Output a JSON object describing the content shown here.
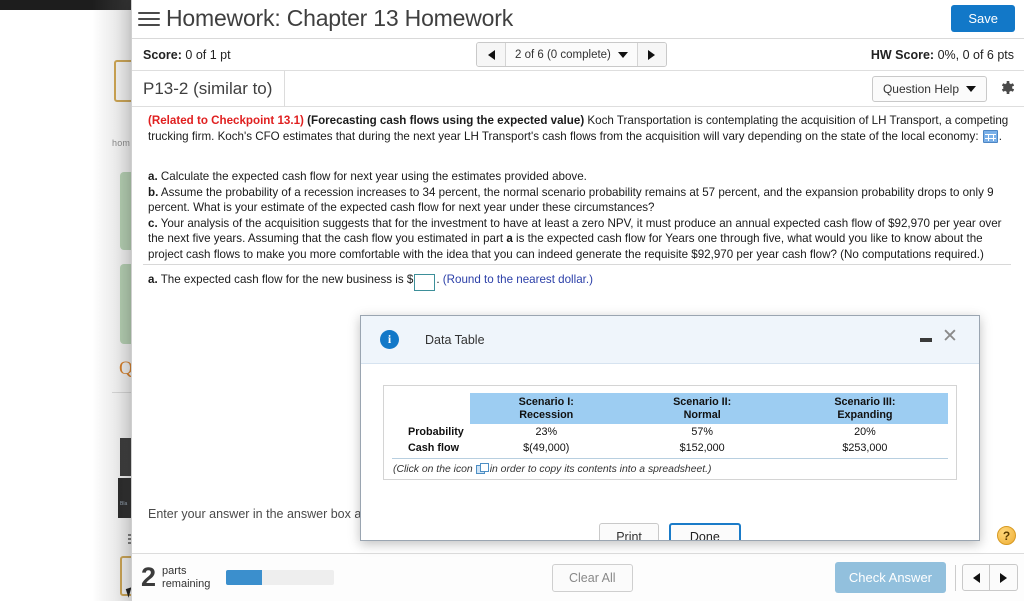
{
  "header": {
    "title": "Homework: Chapter 13 Homework",
    "save_label": "Save",
    "menu_icon": "hamburger-icon"
  },
  "score_row": {
    "score_label": "Score:",
    "score_value": "0 of 1 pt",
    "nav_value": "2 of 6 (0 complete)",
    "prev_icon": "triangle-left-icon",
    "next_icon": "triangle-right-icon",
    "hw_score_label": "HW Score:",
    "hw_score_value": "0%, 0 of 6 pts"
  },
  "problem_row": {
    "problem_id": "P13-2 (similar to)",
    "question_help_label": "Question Help",
    "gear_icon": "gear-icon"
  },
  "question": {
    "checkpoint": "(Related to Checkpoint 13.1)",
    "topic": "(Forecasting cash flows using the expected value)",
    "para1_a": "Koch Transportation is contemplating the acquisition of LH Transport, a competing trucking firm. Koch's CFO estimates that during the next year LH Transport's cash flows from the acquisition will vary depending on the state of the local economy:",
    "para1_period": ".",
    "grid_icon": "data-table-grid-icon",
    "part_a_label": "a.",
    "part_a_text": "Calculate the expected cash flow for next year using the estimates provided above.",
    "part_b_label": "b.",
    "part_b_text": "Assume the probability of a recession increases to 34 percent, the normal scenario probability remains at 57 percent, and the expansion probability drops to only 9 percent. What is your estimate of the expected cash flow for next year under these circumstances?",
    "part_c_label": "c.",
    "part_c_text_1": "Your analysis of the acquisition suggests that for the investment to have at least a zero NPV, it must produce an annual expected cash flow of $92,970 per year over the next five years. Assuming that the cash flow you estimated in part ",
    "part_c_bold_a": "a",
    "part_c_text_2": " is the expected cash flow for Years one through five, what would you like to know about the project cash flows to make you more comfortable with the idea that you can indeed generate the requisite $92,970 per year cash flow? (No computations required.)",
    "answer_label": "a.",
    "answer_prompt": "The expected cash flow for the new business is $",
    "answer_value": "",
    "answer_period": ".",
    "answer_hint": "(Round to the nearest dollar.)",
    "enter_answer_note": "Enter your answer in the answer box and then click Check Answer."
  },
  "footer": {
    "parts_number": "2",
    "parts_label_line1": "parts",
    "parts_label_line2": "remaining",
    "progress_percent": 33,
    "clear_all_label": "Clear All",
    "check_answer_label": "Check Answer",
    "prev_icon": "triangle-left-icon",
    "next_icon": "triangle-right-icon",
    "help_label": "?"
  },
  "modal": {
    "info_icon": "info-icon",
    "title": "Data Table",
    "minimize_icon": "minimize-icon",
    "close_icon": "close-icon",
    "table": {
      "blank_corner": "",
      "headers": [
        {
          "line1": "Scenario I:",
          "line2": "Recession"
        },
        {
          "line1": "Scenario II:",
          "line2": "Normal"
        },
        {
          "line1": "Scenario III:",
          "line2": "Expanding"
        }
      ],
      "rows": [
        {
          "label": "Probability",
          "values": [
            "23%",
            "57%",
            "20%"
          ]
        },
        {
          "label": "Cash flow",
          "values": [
            "$(49,000)",
            "$152,000",
            "$253,000"
          ]
        }
      ]
    },
    "copy_note_1": "(Click on the icon",
    "copy_icon": "copy-to-spreadsheet-icon",
    "copy_note_2": "in order to copy its contents into a spreadsheet.)",
    "print_label": "Print",
    "done_label": "Done"
  },
  "background": {
    "hom_text": "hom",
    "q_letter": "Q",
    "dark_text": "]",
    "dark_small_text": "Bla"
  },
  "colors": {
    "accent_blue": "#1278c8",
    "table_header_blue": "#9dcdf2",
    "alert_red": "#e02020",
    "progress_blue": "#3b8fcd",
    "disabled_blue": "#92c0dd",
    "help_orange": "#eeae35"
  }
}
